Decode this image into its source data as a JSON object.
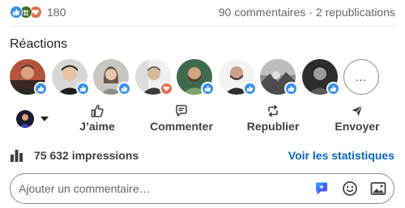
{
  "post_stats": {
    "reaction_icons": [
      "like-reaction-icon",
      "celebrate-reaction-icon",
      "love-reaction-icon"
    ],
    "reaction_count": "180",
    "comments": "90 commentaires",
    "separator": "·",
    "reposts": "2 republications"
  },
  "reactions_section": {
    "title": "Réactions",
    "reactors": [
      {
        "name": "reactor-1",
        "reaction": "like"
      },
      {
        "name": "reactor-2",
        "reaction": "like"
      },
      {
        "name": "reactor-3",
        "reaction": "like"
      },
      {
        "name": "reactor-4",
        "reaction": "love"
      },
      {
        "name": "reactor-5",
        "reaction": "like"
      },
      {
        "name": "reactor-6",
        "reaction": "like"
      },
      {
        "name": "reactor-7",
        "reaction": "like"
      },
      {
        "name": "reactor-8",
        "reaction": "like"
      }
    ],
    "more_label": "…"
  },
  "actions": {
    "like": "J’aime",
    "comment": "Commenter",
    "repost": "Republier",
    "send": "Envoyer"
  },
  "impressions": {
    "label": "75 632 impressions",
    "cta": "Voir les statistiques"
  },
  "composer": {
    "placeholder": "Ajouter un commentaire…",
    "icons": [
      "ai-assist-icon",
      "emoji-icon",
      "image-icon"
    ]
  },
  "colors": {
    "accent": "#0a66c2",
    "like_badge": "#378fe9",
    "celebrate_badge": "#44712e",
    "love_badge": "#df704d"
  }
}
